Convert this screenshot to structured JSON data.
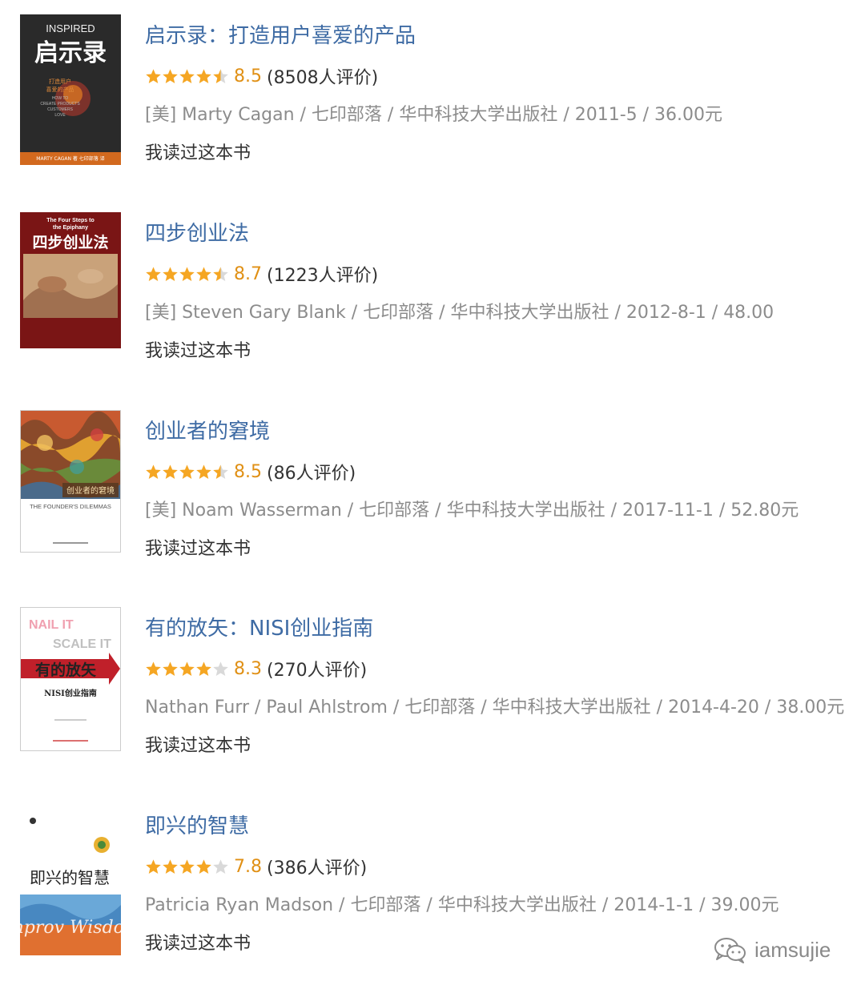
{
  "books": [
    {
      "title": "启示录：打造用户喜爱的产品",
      "rating_value": 4.5,
      "score": "8.5",
      "count": "(8508人评价)",
      "meta": "[美] Marty Cagan / 七印部落 / 华中科技大学出版社 / 2011-5 / 36.00元",
      "status": "我读过这本书",
      "cover": {
        "text_top": "INSPIRED",
        "text_main": "启示录",
        "text_sub1": "打造用户",
        "text_sub2": "喜爱的产品",
        "text_en1": "HOW TO",
        "text_en2": "CREATE PRODUCTS",
        "text_en3": "CUSTOMERS",
        "text_en4": "LOVE",
        "text_author": "MARTY CAGAN 著   七印部落 译"
      }
    },
    {
      "title": "四步创业法",
      "rating_value": 4.5,
      "score": "8.7",
      "count": "(1223人评价)",
      "meta": "[美] Steven Gary Blank / 七印部落 / 华中科技大学出版社 / 2012-8-1 / 48.00",
      "status": "我读过这本书",
      "cover": {
        "text_top1": "The Four Steps to",
        "text_top2": "the Epiphany",
        "text_main": "四步创业法"
      }
    },
    {
      "title": "创业者的窘境",
      "rating_value": 4.5,
      "score": "8.5",
      "count": "(86人评价)",
      "meta": "[美] Noam Wasserman / 七印部落 / 华中科技大学出版社 / 2017-11-1 / 52.80元",
      "status": "我读过这本书",
      "cover": {
        "text_main": "创业者的窘境",
        "text_en": "THE FOUNDER'S DILEMMAS"
      }
    },
    {
      "title": "有的放矢：NISI创业指南",
      "rating_value": 4.0,
      "score": "8.3",
      "count": "(270人评价)",
      "meta": "Nathan Furr / Paul Ahlstrom / 七印部落 / 华中科技大学出版社 / 2014-4-20 / 38.00元",
      "status": "我读过这本书",
      "cover": {
        "text_top1": "NAIL IT",
        "text_top2": "SCALE IT",
        "text_main": "有的放矢",
        "text_sub": "NISI创业指南"
      }
    },
    {
      "title": "即兴的智慧",
      "rating_value": 4.0,
      "score": "7.8",
      "count": "(386人评价)",
      "meta": "Patricia Ryan Madson / 七印部落 / 华中科技大学出版社 / 2014-1-1 / 39.00元",
      "status": "我读过这本书",
      "cover": {
        "text_main": "即兴的智慧",
        "text_en": "Improv Wisdom"
      }
    }
  ],
  "watermark": {
    "icon": "wechat-icon",
    "text": "iamsujie"
  },
  "colors": {
    "title": "#3e6ba4",
    "star_on": "#f5a623",
    "star_off": "#d9d9d9",
    "score": "#e09015",
    "meta": "#8c8c8c"
  }
}
